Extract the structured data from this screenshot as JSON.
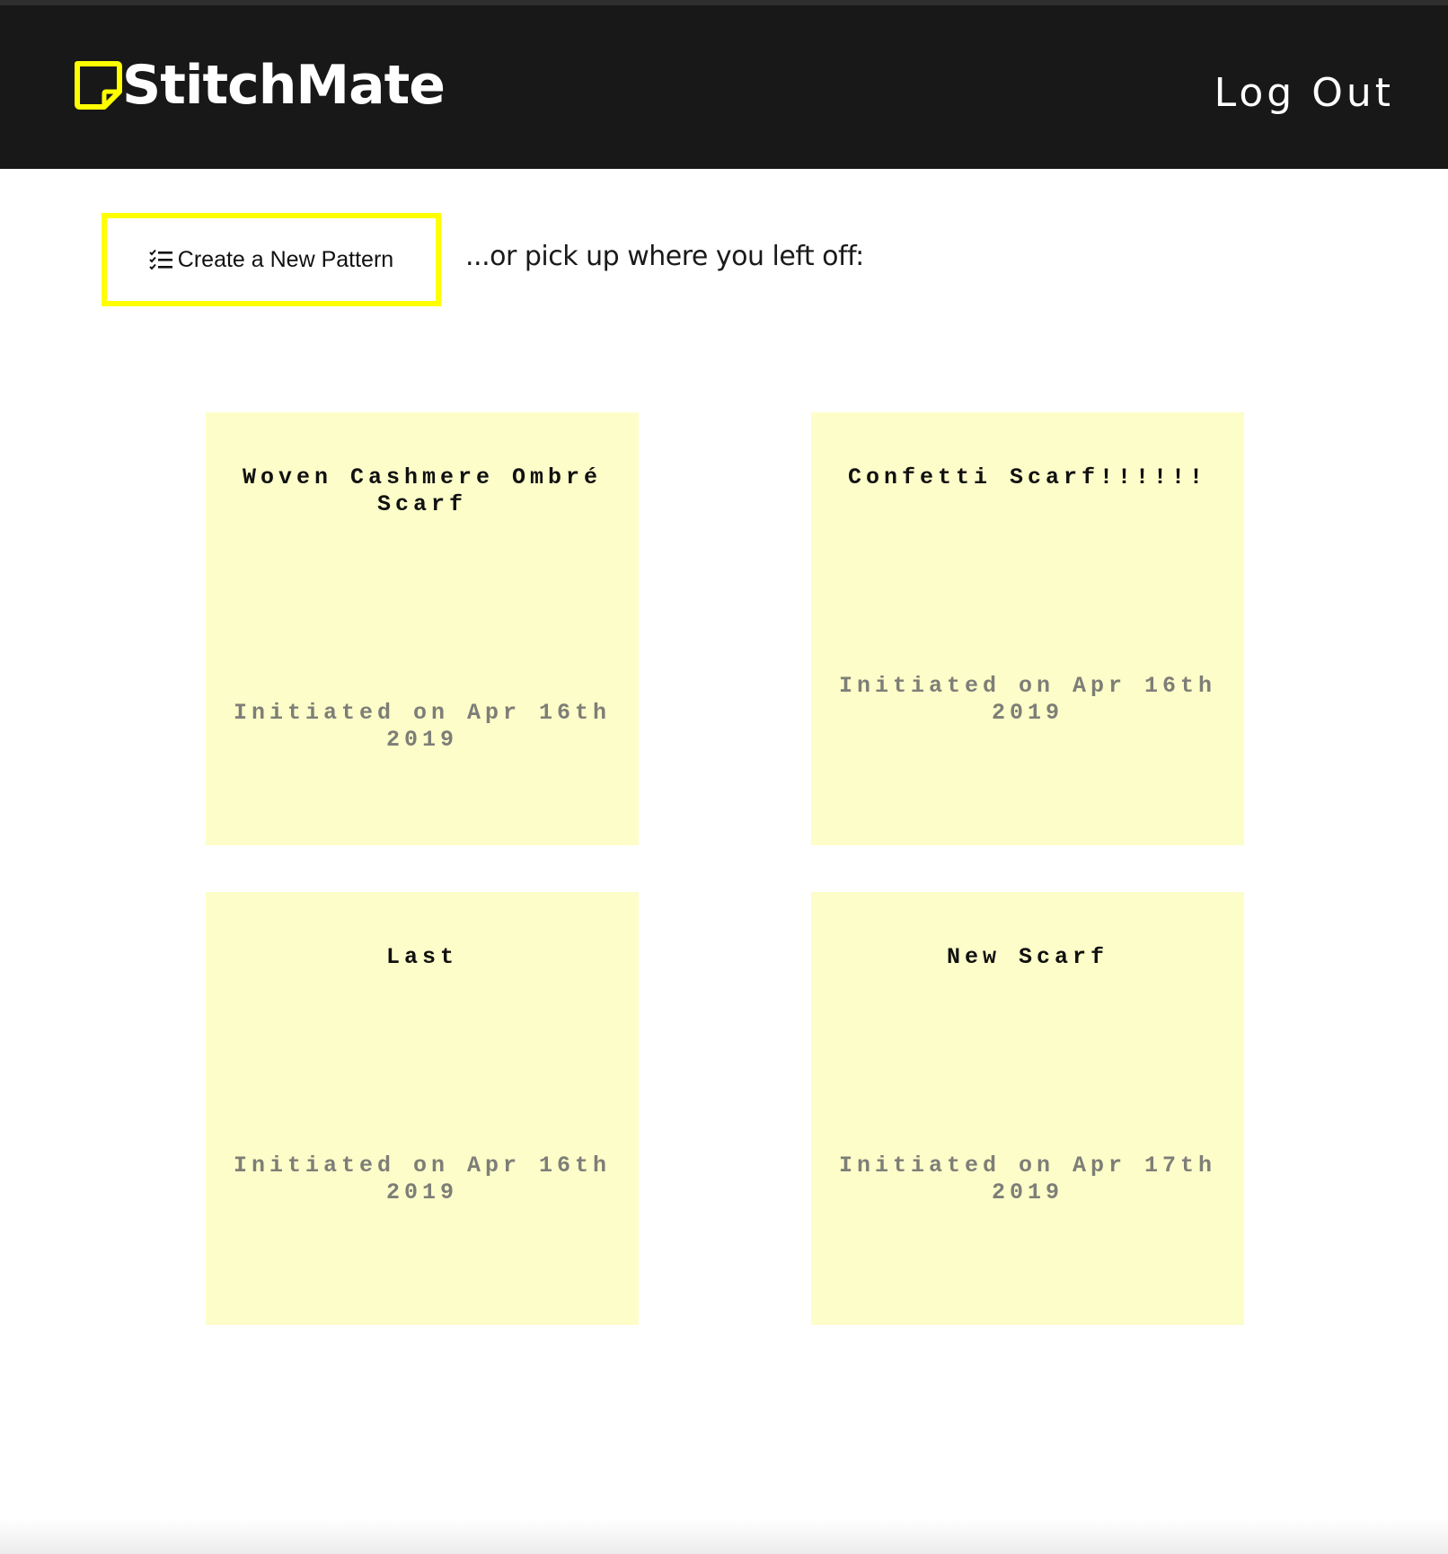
{
  "brand": {
    "name": "StitchMate",
    "logo_icon": "sticky-note-icon",
    "accent_color": "#ffff00"
  },
  "header": {
    "background": "#181818",
    "logout_label": "Log Out"
  },
  "actions": {
    "create_label": "Create a New Pattern",
    "create_icon": "list-check-icon",
    "tagline": "...or pick up where you left off:"
  },
  "patterns": [
    {
      "title": "Woven Cashmere Ombré Scarf",
      "date_line1": "Initiated on Apr 16th",
      "date_line2": "2019"
    },
    {
      "title": "Confetti Scarf!!!!!!",
      "date_line1": "Initiated on Apr 16th",
      "date_line2": "2019"
    },
    {
      "title": "Last",
      "date_line1": "Initiated on Apr 16th",
      "date_line2": "2019"
    },
    {
      "title": "New Scarf",
      "date_line1": "Initiated on Apr 17th",
      "date_line2": "2019"
    }
  ],
  "card_color": "#fdfdc9"
}
